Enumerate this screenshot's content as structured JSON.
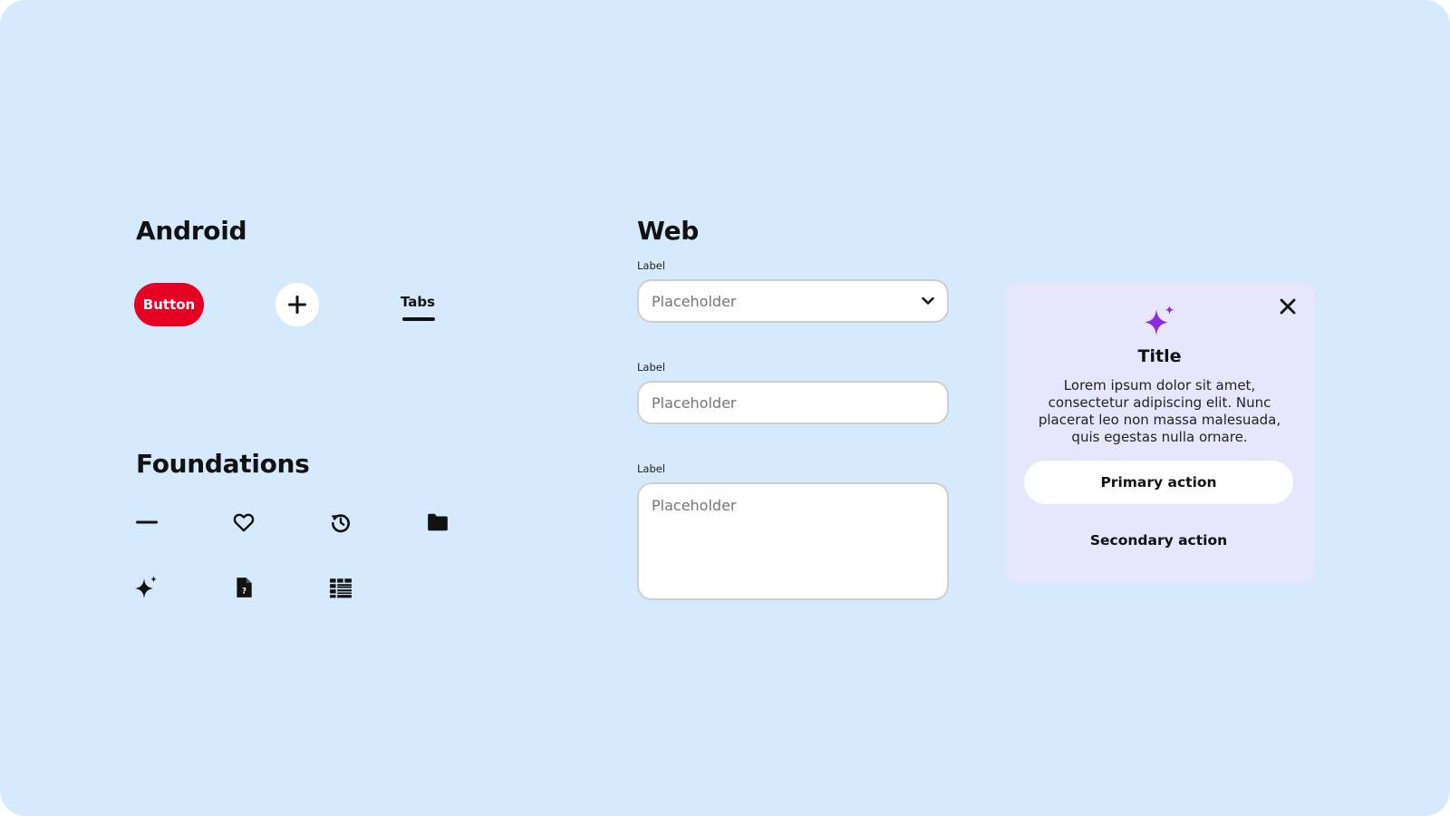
{
  "android": {
    "title": "Android",
    "button_label": "Button",
    "fab_icon": "plus-icon",
    "tab_label": "Tabs"
  },
  "foundations": {
    "title": "Foundations",
    "icons": [
      "minus-icon",
      "heart-icon",
      "history-icon",
      "folder-icon",
      "sparkle-icon",
      "file-question-icon",
      "list-grid-icon"
    ]
  },
  "web": {
    "title": "Web",
    "select": {
      "label": "Label",
      "placeholder": "Placeholder"
    },
    "input": {
      "label": "Label",
      "placeholder": "Placeholder"
    },
    "textarea": {
      "label": "Label",
      "placeholder": "Placeholder"
    }
  },
  "card": {
    "title": "Title",
    "body": "Lorem ipsum dolor sit amet, consectetur adipiscing elit. Nunc placerat leo non massa malesuada, quis egestas nulla ornare.",
    "primary_action": "Primary action",
    "secondary_action": "Secondary action",
    "accent_color": "#8a2be2"
  },
  "colors": {
    "background": "#d6eafd",
    "brand_red": "#e60023",
    "card_background": "#e6e6fc"
  }
}
